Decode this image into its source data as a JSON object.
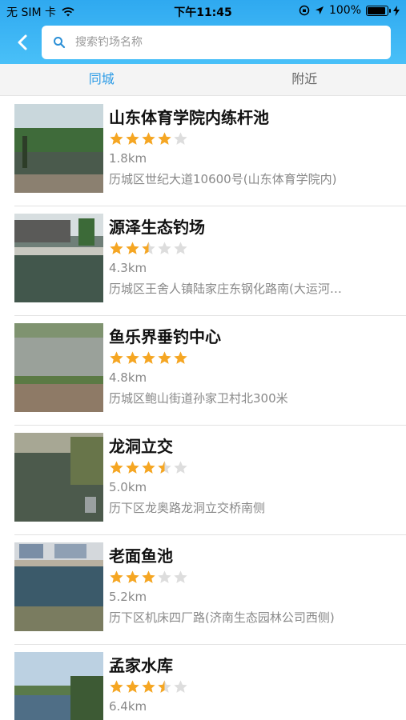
{
  "status_bar": {
    "carrier": "无 SIM 卡",
    "time": "下午11:45",
    "battery": "100%",
    "battery_level": 1.0
  },
  "search": {
    "placeholder": "搜索钓场名称"
  },
  "tabs": [
    {
      "label": "同城",
      "active": true
    },
    {
      "label": "附近",
      "active": false
    }
  ],
  "spots": [
    {
      "name": "山东体育学院内练杆池",
      "rating": 4,
      "distance": "1.8km",
      "address": "历城区世纪大道10600号(山东体育学院内)",
      "photo": "pond-with-trees"
    },
    {
      "name": "源泽生态钓场",
      "rating": 2.5,
      "distance": "4.3km",
      "address": "历城区王舍人镇陆家庄东钢化路南(大运河生态园)",
      "photo": "pond-with-building"
    },
    {
      "name": "鱼乐界垂钓中心",
      "rating": 5,
      "distance": "4.8km",
      "address": "历城区鲍山街道孙家卫村北300米",
      "photo": "reservoir-bank"
    },
    {
      "name": "龙洞立交",
      "rating": 3.5,
      "distance": "5.0km",
      "address": "历下区龙奥路龙洞立交桥南侧",
      "photo": "river-with-reeds"
    },
    {
      "name": "老面鱼池",
      "rating": 3,
      "distance": "5.2km",
      "address": "历下区机床四厂路(济南生态园林公司西侧)",
      "photo": "pond-with-people"
    },
    {
      "name": "孟家水库",
      "rating": 3.5,
      "distance": "6.4km",
      "address": "",
      "photo": "reservoir-sky"
    }
  ],
  "colors": {
    "header": "#3ab4f4",
    "star_on": "#f5a623",
    "star_off": "#dddddd",
    "tab_active": "#2b9be6"
  }
}
